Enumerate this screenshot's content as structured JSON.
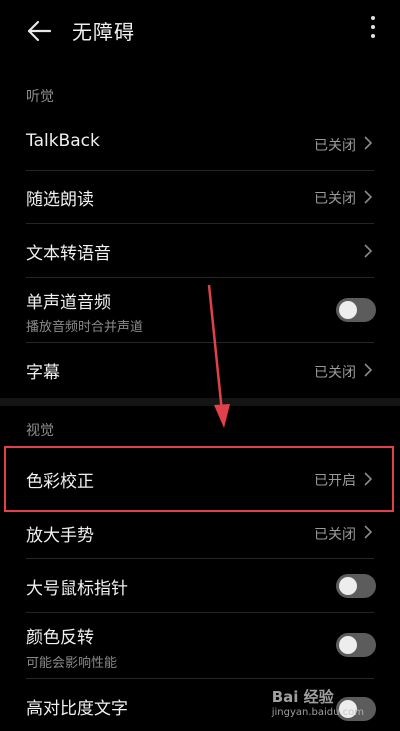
{
  "header": {
    "title": "无障碍"
  },
  "sections": [
    {
      "label": "听觉"
    },
    {
      "label": "视觉"
    }
  ],
  "hearing": [
    {
      "label": "TalkBack",
      "status": "已关闭"
    },
    {
      "label": "随选朗读",
      "status": "已关闭"
    },
    {
      "label": "文本转语音"
    },
    {
      "label": "单声道音频",
      "sub": "播放音频时合并声道",
      "toggle": "off"
    },
    {
      "label": "字幕",
      "status": "已关闭"
    }
  ],
  "vision": [
    {
      "label": "色彩校正",
      "status": "已开启"
    },
    {
      "label": "放大手势",
      "status": "已关闭"
    },
    {
      "label": "大号鼠标指针",
      "toggle": "off"
    },
    {
      "label": "颜色反转",
      "sub": "可能会影响性能",
      "toggle": "off"
    },
    {
      "label": "高对比度文字"
    }
  ],
  "annotation": {
    "highlight_color": "#e2404a"
  },
  "watermark": {
    "line1": "Bai 经验",
    "line2": "jingyan.baidu.com"
  }
}
